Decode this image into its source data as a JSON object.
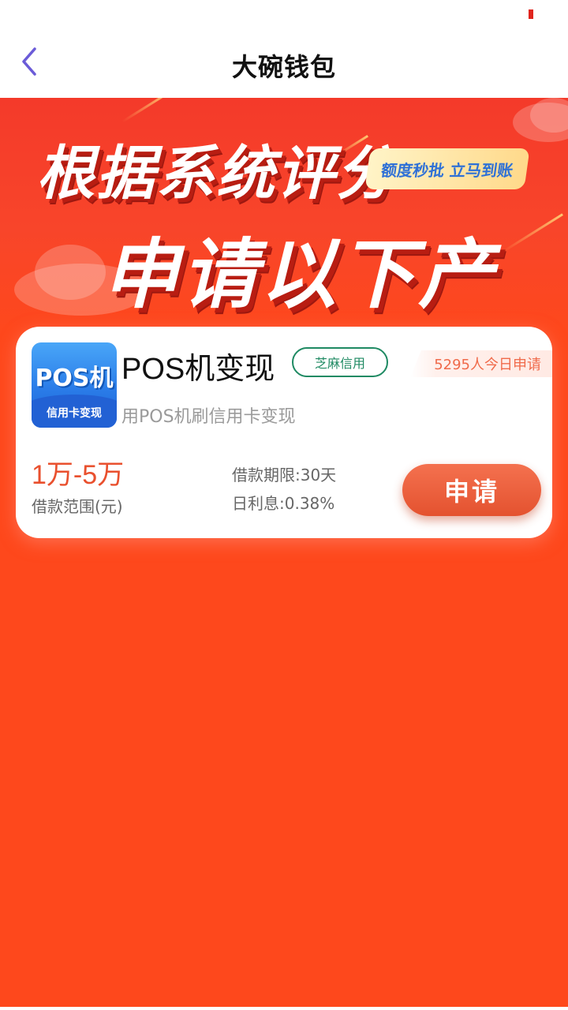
{
  "nav": {
    "title": "大碗钱包"
  },
  "banner": {
    "line1": "根据系统评分",
    "tag": "额度秒批 立马到账",
    "line2": "申请以下产品"
  },
  "product": {
    "logo_main": "POS机",
    "logo_sub": "信用卡变现",
    "name": "POS机变现",
    "badge": "芝麻信用",
    "apply_count": "5295人今日申请",
    "description": "用POS机刷信用卡变现",
    "amount_range": "1万-5万",
    "amount_label": "借款范围(元)",
    "loan_term": "借款期限:30天",
    "daily_rate": "日利息:0.38%",
    "apply_label": "申请"
  },
  "colors": {
    "background": "#fe481c",
    "accent": "#e9502e",
    "badge": "#1f8a63",
    "back_icon": "#6b5bd8"
  },
  "icons": {
    "back": "chevron-left-icon"
  }
}
